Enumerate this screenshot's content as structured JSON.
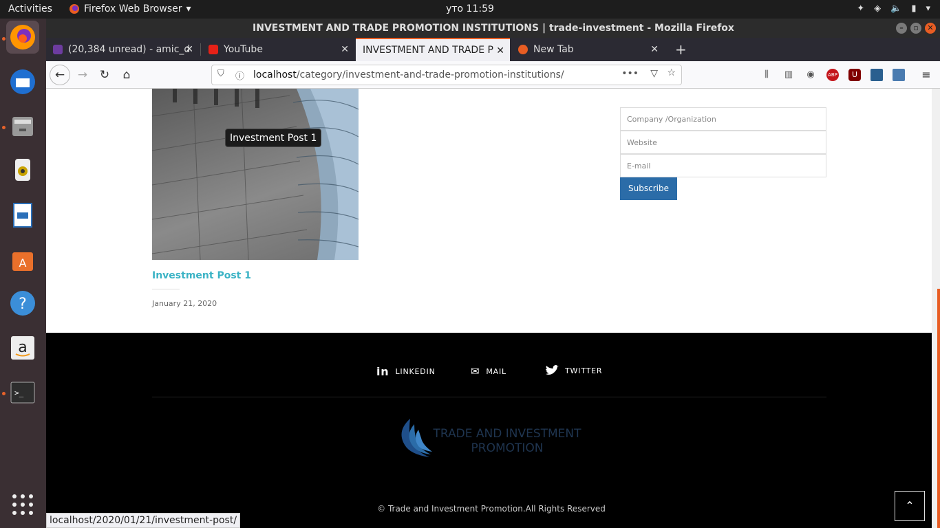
{
  "topbar": {
    "activities": "Activities",
    "app_menu": "Firefox Web Browser",
    "clock": "уто 11:59"
  },
  "window": {
    "title": "INVESTMENT AND TRADE PROMOTION INSTITUTIONS | trade-investment - Mozilla Firefox"
  },
  "tabs": [
    {
      "label": "(20,384 unread) - amic_d",
      "favicon_color": "#6d3ca0"
    },
    {
      "label": "YouTube",
      "favicon_color": "#e62117"
    },
    {
      "label": "INVESTMENT AND TRADE P",
      "favicon_color": "#e85d23"
    },
    {
      "label": "New Tab",
      "favicon_color": "#e85d23"
    }
  ],
  "navbar": {
    "url_host": "localhost",
    "url_path": "/category/investment-and-trade-promotion-institutions/"
  },
  "page": {
    "tooltip": "Investment Post 1",
    "post_title": "Investment Post 1",
    "post_date": "January 21, 2020",
    "form": {
      "company_placeholder": "Company /Organization",
      "website_placeholder": "Website",
      "email_placeholder": "E-mail",
      "subscribe_label": "Subscribe"
    }
  },
  "footer": {
    "social": [
      {
        "label": "LINKEDIN",
        "icon": "linkedin-icon"
      },
      {
        "label": "MAIL",
        "icon": "mail-icon"
      },
      {
        "label": "TWITTER",
        "icon": "twitter-icon"
      }
    ],
    "logo_line1": "TRADE AND INVESTMENT",
    "logo_line2": "PROMOTION",
    "copyright": "© Trade and Investment Promotion.All Rights Reserved",
    "to_top_icon": "chevron-up-icon"
  },
  "status_bar": {
    "url": "localhost/2020/01/21/investment-post/"
  },
  "colors": {
    "accent": "#e85d23",
    "link": "#3bb3c5",
    "subscribe": "#2b6ca8"
  }
}
